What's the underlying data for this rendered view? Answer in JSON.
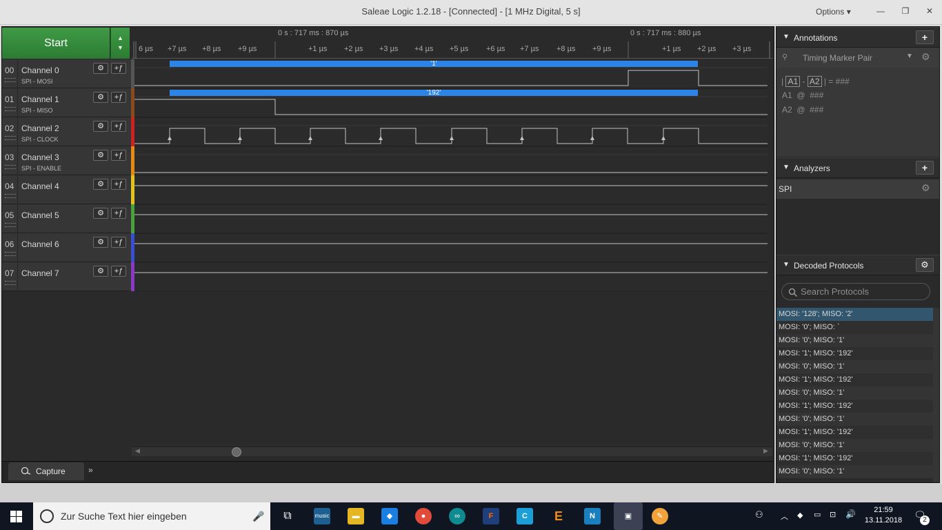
{
  "window": {
    "title": "Saleae Logic 1.2.18 - [Connected] - [1 MHz Digital, 5 s]",
    "options_label": "Options ▾",
    "minimize": "—",
    "maximize": "❐",
    "close": "✕"
  },
  "controls": {
    "start_label": "Start"
  },
  "ruler": {
    "label_left": "0 s : 717 ms : 870 µs",
    "label_right": "0 s : 717 ms : 880 µs",
    "ticks": [
      "6 µs",
      "+7 µs",
      "+8 µs",
      "+9 µs",
      "+1 µs",
      "+2 µs",
      "+3 µs",
      "+4 µs",
      "+5 µs",
      "+6 µs",
      "+7 µs",
      "+8 µs",
      "+9 µs",
      "+1 µs",
      "+2 µs",
      "+3 µs"
    ]
  },
  "channels": [
    {
      "num": "00",
      "name": "Channel 0",
      "sub": "SPI - MOSI",
      "color": "#555555"
    },
    {
      "num": "01",
      "name": "Channel 1",
      "sub": "SPI - MISO",
      "color": "#8b4a1c"
    },
    {
      "num": "02",
      "name": "Channel 2",
      "sub": "SPI - CLOCK",
      "color": "#cc2222"
    },
    {
      "num": "03",
      "name": "Channel 3",
      "sub": "SPI - ENABLE",
      "color": "#e38a14"
    },
    {
      "num": "04",
      "name": "Channel 4",
      "sub": "",
      "color": "#e2c21b"
    },
    {
      "num": "05",
      "name": "Channel 5",
      "sub": "",
      "color": "#4aa23a"
    },
    {
      "num": "06",
      "name": "Channel 6",
      "sub": "",
      "color": "#3a4fd0"
    },
    {
      "num": "07",
      "name": "Channel 7",
      "sub": "",
      "color": "#8a39c5"
    }
  ],
  "decode_bubbles": {
    "mosi": "'1'",
    "miso": "'192'"
  },
  "capture": {
    "tab_label": "Capture",
    "more": "»"
  },
  "annotations": {
    "header": "Annotations",
    "add": "+",
    "timing_marker": "Timing Marker Pair",
    "formula_a1": "A1",
    "formula_a2": "A2",
    "formula_result": "###",
    "a1_label": "A1",
    "a1_value": "###",
    "a2_label": "A2",
    "a2_value": "###"
  },
  "analyzers": {
    "header": "Analyzers",
    "add": "+",
    "items": [
      "SPI"
    ]
  },
  "decoded": {
    "header": "Decoded Protocols",
    "search_placeholder": "Search Protocols",
    "items": [
      "MOSI: '128';  MISO: '2'",
      "MOSI: '0';  MISO: `",
      "MOSI: '0';  MISO: '1'",
      "MOSI: '1';  MISO: '192'",
      "MOSI: '0';  MISO: '1'",
      "MOSI: '1';  MISO: '192'",
      "MOSI: '0';  MISO: '1'",
      "MOSI: '1';  MISO: '192'",
      "MOSI: '0';  MISO: '1'",
      "MOSI: '1';  MISO: '192'",
      "MOSI: '0';  MISO: '1'",
      "MOSI: '1';  MISO: '192'",
      "MOSI: '0';  MISO: '1'"
    ]
  },
  "taskbar": {
    "search_placeholder": "Zur Suche Text hier eingeben",
    "time": "21:59",
    "date": "13.11.2018",
    "notifications": "2"
  }
}
